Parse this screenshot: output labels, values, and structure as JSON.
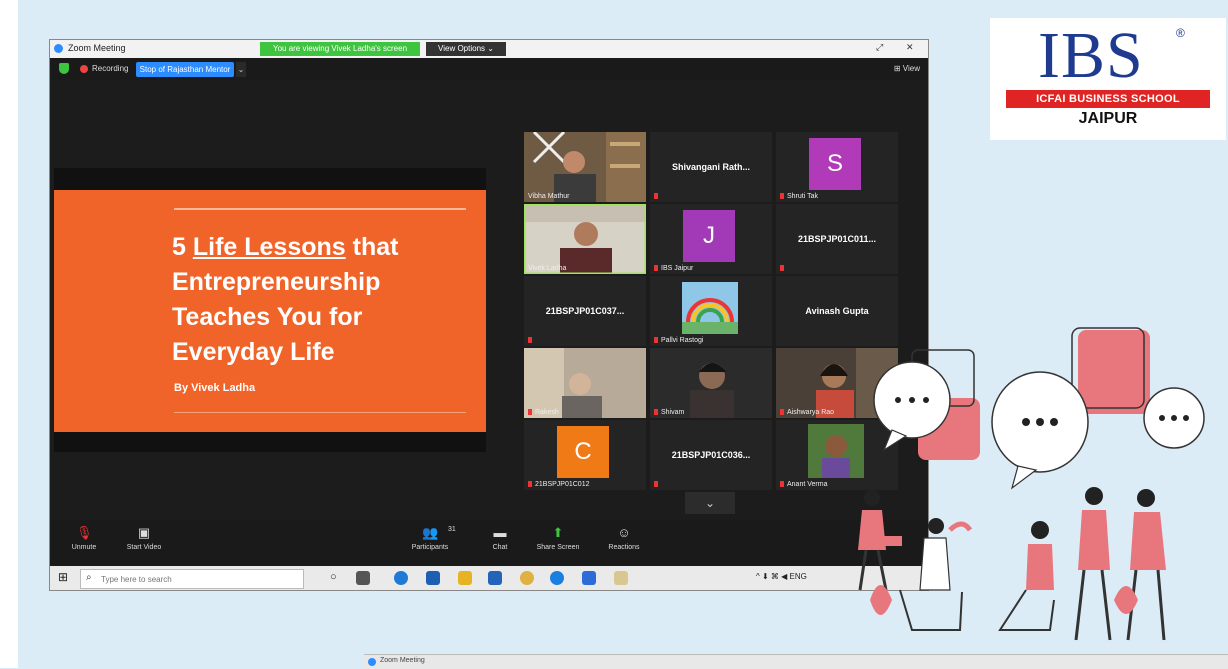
{
  "window": {
    "app_title": "Zoom Meeting",
    "share_banner": "You are viewing Vivek Ladha's screen",
    "view_options": "View Options ⌄",
    "controls": [
      "⤢",
      "✕"
    ]
  },
  "top_bar": {
    "recording": "Recording",
    "viewing_button": "Stop of Rajasthan Mentor",
    "caret": "⌄",
    "view": "⊞ View"
  },
  "slide": {
    "title_pre": "5 ",
    "title_link": "Life Lessons",
    "title_post": " that Entrepreneurship Teaches You for Everyday Life",
    "author": "By Vivek Ladha"
  },
  "gallery": {
    "tiles": [
      {
        "kind": "video",
        "name": "Vibha Mathur"
      },
      {
        "kind": "text",
        "center": "Shivangani Rath...",
        "name": ""
      },
      {
        "kind": "avatar",
        "letter": "S",
        "color": "#b03ab8",
        "name": "Shruti Tak"
      },
      {
        "kind": "video",
        "name": "Vivek Ladha",
        "active": true
      },
      {
        "kind": "avatar",
        "letter": "J",
        "color": "#a23ab8",
        "name": "IBS Jaipur"
      },
      {
        "kind": "text",
        "center": "21BSPJP01C011...",
        "name": ""
      },
      {
        "kind": "text",
        "center": "21BSPJP01C037...",
        "name": ""
      },
      {
        "kind": "video",
        "name": "Pallvi Rastogi"
      },
      {
        "kind": "text",
        "center": "Avinash Gupta",
        "name": ""
      },
      {
        "kind": "video",
        "name": "Rakesh"
      },
      {
        "kind": "video",
        "name": "Shivam"
      },
      {
        "kind": "video",
        "name": "Aishwarya Rao"
      },
      {
        "kind": "avatar",
        "letter": "C",
        "color": "#f07a16",
        "name": "21BSPJP01C012"
      },
      {
        "kind": "text",
        "center": "21BSPJP01C036...",
        "name": ""
      },
      {
        "kind": "video",
        "name": "Anant Verma"
      }
    ],
    "more": "⌄"
  },
  "bottom_toolbar": {
    "unmute": "Unmute",
    "start_video": "Start Video",
    "participants": "Participants",
    "participants_count": "31",
    "chat": "Chat",
    "share_screen": "Share Screen",
    "reactions": "Reactions"
  },
  "taskbar": {
    "search_placeholder": "Type here to search",
    "tray": "^ ⬇ ⌘ ◀ ENG"
  },
  "logo": {
    "brand": "IBS",
    "registered": "®",
    "band": "ICFAI BUSINESS SCHOOL",
    "city": "JAIPUR"
  },
  "bottom_strip": {
    "title": "Zoom Meeting"
  },
  "colors": {
    "slide_bg": "#f0642a",
    "logo_blue": "#1f3b8f",
    "logo_red": "#e02424",
    "bubble_pink": "#e8777d"
  }
}
